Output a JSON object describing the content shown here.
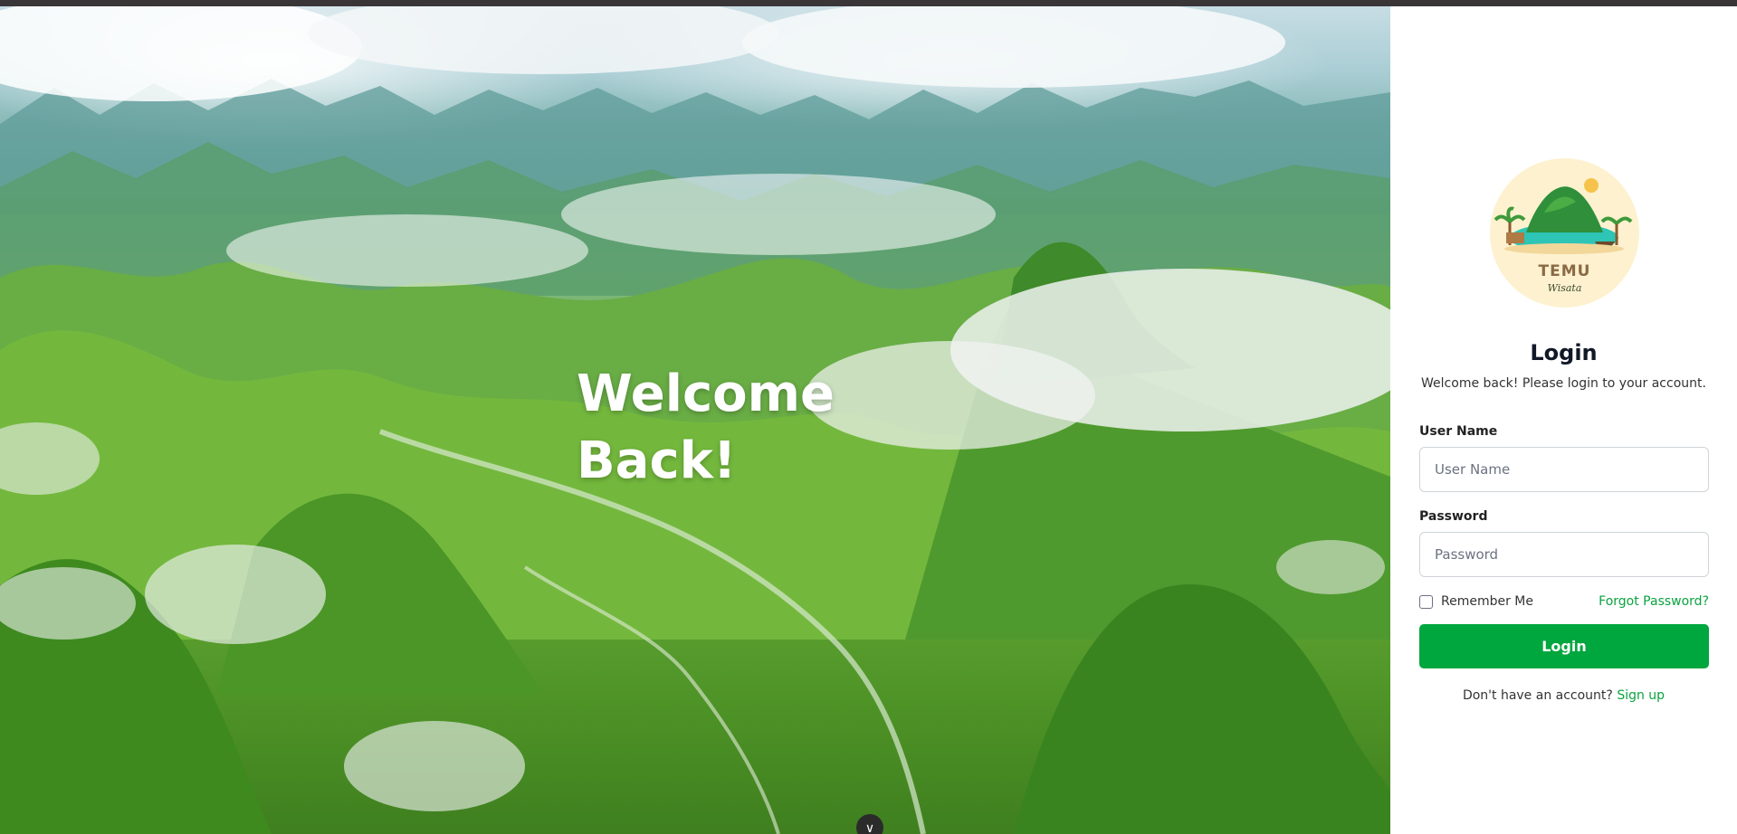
{
  "hero": {
    "title_line1": "Welcome",
    "title_line2": "Back!"
  },
  "logo": {
    "brand_top": "TEMU",
    "brand_bottom": "Wisata"
  },
  "login": {
    "title": "Login",
    "subtitle": "Welcome back! Please login to your account.",
    "username_label": "User Name",
    "username_placeholder": "User Name",
    "username_value": "",
    "password_label": "Password",
    "password_placeholder": "Password",
    "password_value": "",
    "remember_label": "Remember Me",
    "remember_checked": false,
    "forgot_label": "Forgot Password?",
    "submit_label": "Login",
    "signup_prompt": "Don't have an account?",
    "signup_link": "Sign up"
  },
  "colors": {
    "accent": "#00a63e",
    "link": "#0aa33f",
    "logo_bg": "#fdf1cf"
  },
  "icons": {
    "scroll": "chevron-down-icon"
  }
}
